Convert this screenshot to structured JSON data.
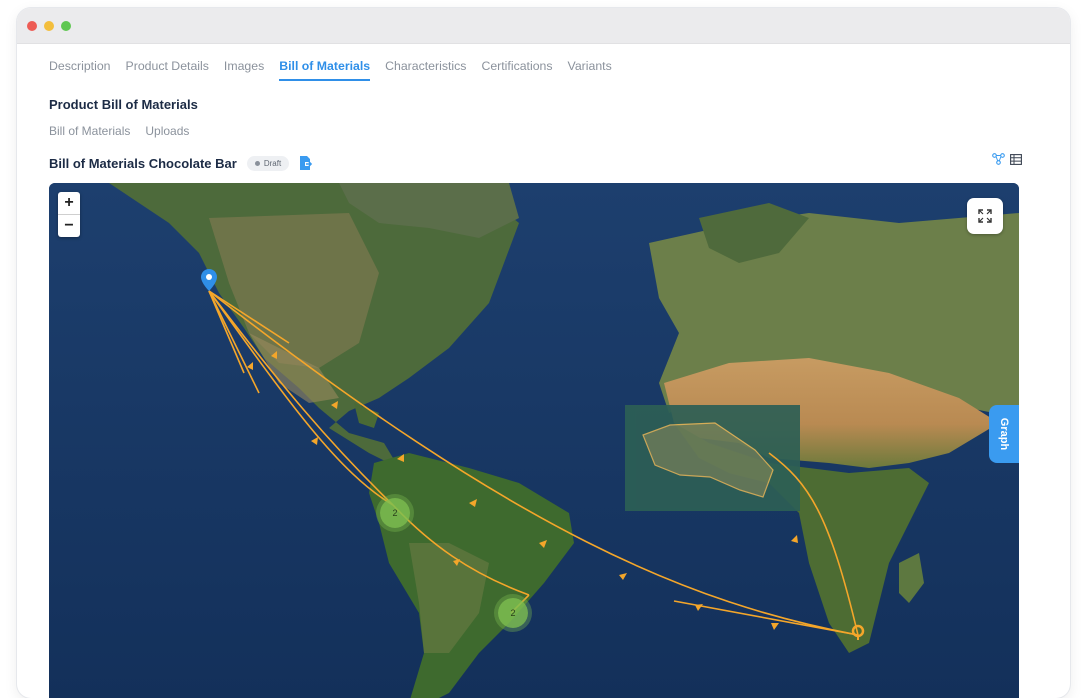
{
  "tabs": [
    {
      "label": "Description",
      "active": false
    },
    {
      "label": "Product Details",
      "active": false
    },
    {
      "label": "Images",
      "active": false
    },
    {
      "label": "Bill of Materials",
      "active": true
    },
    {
      "label": "Characteristics",
      "active": false
    },
    {
      "label": "Certifications",
      "active": false
    },
    {
      "label": "Variants",
      "active": false
    }
  ],
  "section_title": "Product Bill of Materials",
  "subtabs": [
    "Bill of Materials",
    "Uploads"
  ],
  "bom": {
    "title": "Bill of Materials Chocolate Bar",
    "status": "Draft",
    "export_icon": "file-export-icon"
  },
  "view_icons": [
    "graph-view-icon",
    "table-view-icon"
  ],
  "map": {
    "zoom_in": "+",
    "zoom_out": "−",
    "fullscreen_icon": "expand-icon",
    "graph_tab": "Graph",
    "clusters": [
      {
        "label": "2"
      },
      {
        "label": "2"
      }
    ],
    "route_color": "#f4a62a",
    "origin_marker_color": "#2f8fe8"
  },
  "colors": {
    "accent": "#2f8fe8",
    "title": "#1c2b45",
    "muted": "#8b929c",
    "traffic_red": "#ed5c55",
    "traffic_yellow": "#f3be3c",
    "traffic_green": "#5fc751"
  }
}
